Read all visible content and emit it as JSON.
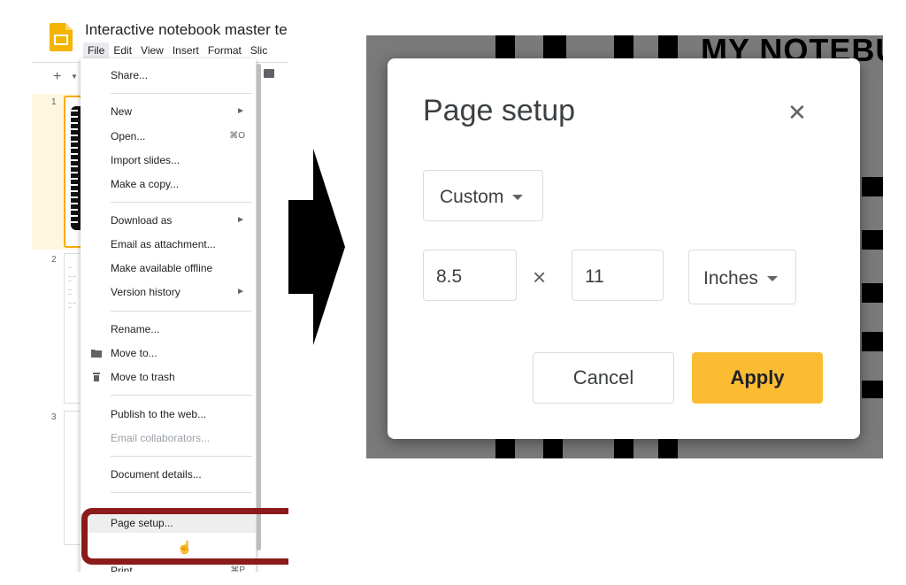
{
  "app": {
    "title": "Interactive notebook master te",
    "menu": [
      "File",
      "Edit",
      "View",
      "Insert",
      "Format",
      "Slic"
    ]
  },
  "slides": {
    "numbers": [
      "1",
      "2",
      "3"
    ]
  },
  "file_menu": {
    "items": [
      {
        "label": "Share...",
        "shortcut": ""
      },
      {
        "label": "New",
        "shortcut": "►"
      },
      {
        "label": "Open...",
        "shortcut": "⌘O"
      },
      {
        "label": "Import slides...",
        "shortcut": ""
      },
      {
        "label": "Make a copy...",
        "shortcut": ""
      },
      {
        "label": "Download as",
        "shortcut": "►"
      },
      {
        "label": "Email as attachment...",
        "shortcut": ""
      },
      {
        "label": "Make available offline",
        "shortcut": ""
      },
      {
        "label": "Version history",
        "shortcut": "►"
      },
      {
        "label": "Rename...",
        "shortcut": ""
      },
      {
        "label": "Move to...",
        "shortcut": ""
      },
      {
        "label": "Move to trash",
        "shortcut": ""
      },
      {
        "label": "Publish to the web...",
        "shortcut": ""
      },
      {
        "label": "Email collaborators...",
        "shortcut": ""
      },
      {
        "label": "Document details...",
        "shortcut": ""
      },
      {
        "label": "Page setup...",
        "shortcut": ""
      },
      {
        "label": "Print",
        "shortcut": "⌘P"
      }
    ]
  },
  "dialog": {
    "title": "Page setup",
    "preset": "Custom",
    "width": "8.5",
    "times": "×",
    "height": "11",
    "unit": "Inches",
    "cancel": "Cancel",
    "apply": "Apply"
  },
  "background": {
    "title": "MY NOTEBU"
  },
  "colors": {
    "accent": "#fbbc34",
    "highlight": "#8b1a1a",
    "selected_slide": "#f9ab00"
  }
}
